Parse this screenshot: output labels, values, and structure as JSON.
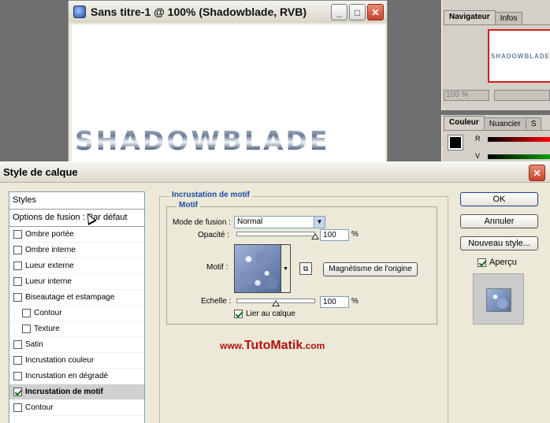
{
  "document_window": {
    "title": "Sans titre-1 @ 100% (Shadowblade, RVB)",
    "canvas_text": "SHADOWBLADE"
  },
  "navigator_panel": {
    "tabs": [
      "Navigateur",
      "Infos"
    ],
    "thumbnail_text": "SHADOWBLADE",
    "zoom": "100 %"
  },
  "color_panel": {
    "tabs": [
      "Couleur",
      "Nuancier",
      "S"
    ],
    "channel_labels": [
      "R",
      "V"
    ]
  },
  "dialog": {
    "title": "Style de calque",
    "styles_header": "Styles",
    "fusion_options": "Options de fusion : Par défaut",
    "style_items": [
      {
        "label": "Ombre portée",
        "checked": false,
        "sub": false
      },
      {
        "label": "Ombre interne",
        "checked": false,
        "sub": false
      },
      {
        "label": "Lueur externe",
        "checked": false,
        "sub": false
      },
      {
        "label": "Lueur interne",
        "checked": false,
        "sub": false
      },
      {
        "label": "Biseautage et estampage",
        "checked": false,
        "sub": false
      },
      {
        "label": "Contour",
        "checked": false,
        "sub": true
      },
      {
        "label": "Texture",
        "checked": false,
        "sub": true
      },
      {
        "label": "Satin",
        "checked": false,
        "sub": false
      },
      {
        "label": "Incrustation couleur",
        "checked": false,
        "sub": false
      },
      {
        "label": "Incrustation en dégradé",
        "checked": false,
        "sub": false
      },
      {
        "label": "Incrustation de motif",
        "checked": true,
        "sub": false,
        "selected": true
      },
      {
        "label": "Contour",
        "checked": false,
        "sub": false
      }
    ],
    "section_title": "Incrustation de motif",
    "motif_group_title": "Motif",
    "blend_mode_label": "Mode de fusion :",
    "blend_mode_value": "Normal",
    "opacity_label": "Opacité :",
    "opacity_value": "100",
    "motif_label": "Motif :",
    "snap_origin_button": "Magnétisme de l'origine",
    "scale_label": "Echelle :",
    "scale_value": "100",
    "percent": "%",
    "link_layer_label": "Lier au calque",
    "link_layer_checked": true,
    "opacity_level": 1.0,
    "scale_slider_level": 0.5,
    "watermark": {
      "prefix": "www.",
      "brand": "TutoMatik",
      "suffix": ".com"
    },
    "ok_button": "OK",
    "cancel_button": "Annuler",
    "new_style_button": "Nouveau style...",
    "preview_label": "Aperçu",
    "preview_checked": true
  },
  "colors": {
    "section_title": "#1d4aa6",
    "watermark": "#b21010",
    "selected_row": "#d0d0d0"
  }
}
